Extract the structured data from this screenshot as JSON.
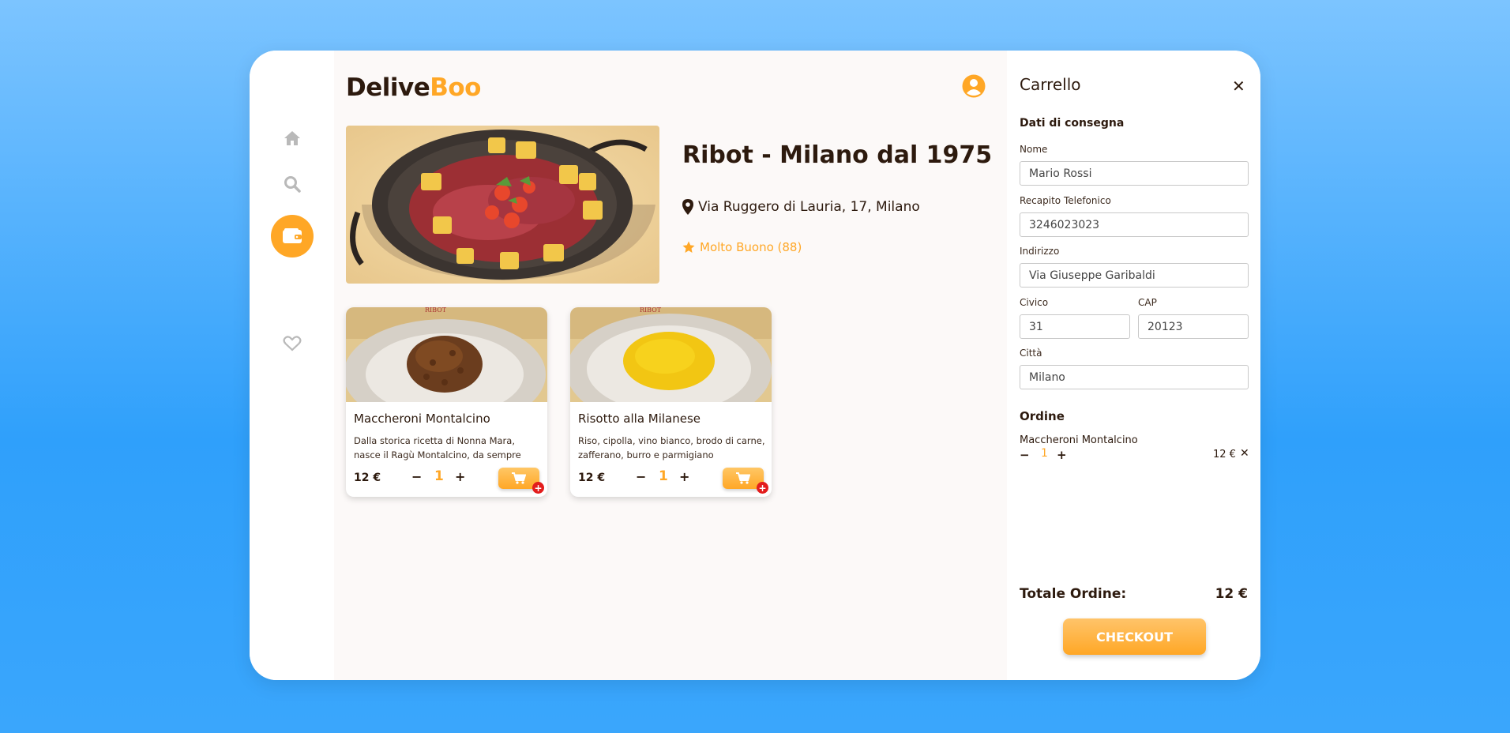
{
  "sidebar": {
    "items": [
      {
        "icon": "home-icon"
      },
      {
        "icon": "search-icon"
      },
      {
        "icon": "utensils-icon"
      },
      {
        "icon": "wallet-icon",
        "active": true
      },
      {
        "icon": "heart-icon"
      }
    ]
  },
  "header": {
    "logo_part1": "Delive",
    "logo_part2": "Boo",
    "user_icon": "user-circle-icon"
  },
  "restaurant": {
    "name": "Ribot - Milano dal 1975",
    "address": "Via Ruggero di Lauria, 17, Milano",
    "rating": "Molto Buono (88)"
  },
  "menu": [
    {
      "name": "Maccheroni Montalcino",
      "description": "Dalla storica ricetta di Nonna Mara, nasce il Ragù Montalcino, da sempre",
      "price": "12 €",
      "qty_minus": "−",
      "qty": "1",
      "qty_plus": "+"
    },
    {
      "name": "Risotto alla Milanese",
      "description": "Riso, cipolla, vino bianco, brodo di carne, zafferano, burro e parmigiano",
      "price": "12 €",
      "qty_minus": "−",
      "qty": "1",
      "qty_plus": "+"
    }
  ],
  "cart": {
    "title": "Carrello",
    "close": "✕",
    "delivery_title": "Dati di consegna",
    "fields": {
      "nome_label": "Nome",
      "nome_value": "Mario Rossi",
      "tel_label": "Recapito Telefonico",
      "tel_value": "3246023023",
      "indirizzo_label": "Indirizzo",
      "indirizzo_value": "Via Giuseppe Garibaldi",
      "civico_label": "Civico",
      "civico_value": "31",
      "cap_label": "CAP",
      "cap_value": "20123",
      "citta_label": "Città",
      "citta_value": "Milano"
    },
    "order_title": "Ordine",
    "order_items": [
      {
        "name": "Maccheroni Montalcino",
        "minus": "−",
        "qty": "1",
        "plus": "+",
        "price": "12 €",
        "remove": "✕"
      }
    ],
    "total_label": "Totale Ordine:",
    "total_value": "12 €",
    "checkout_label": "CHECKOUT"
  },
  "colors": {
    "accent": "#ffa726",
    "text": "#2d1a0e",
    "background_top": "#7cc4ff",
    "background_bottom": "#2fa0fb",
    "badge_red": "#e31d1d"
  }
}
